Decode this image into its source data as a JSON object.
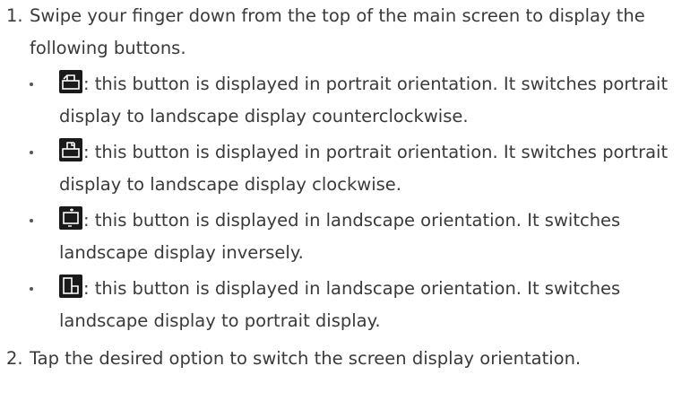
{
  "steps": [
    {
      "number": "1.",
      "text": "Swipe your finger down from the top of the main screen to display the following buttons.",
      "bullets": [
        {
          "icon": "rotate-left-icon",
          "text": ": this button is displayed in portrait orientation. It switches portrait display to landscape display counterclockwise."
        },
        {
          "icon": "rotate-right-icon",
          "text": ": this button is displayed in portrait orientation. It switches portrait display to landscape display clockwise."
        },
        {
          "icon": "flip-icon",
          "text": ": this button is displayed in landscape orientation. It switches landscape display inversely."
        },
        {
          "icon": "portrait-icon",
          "text": ": this button is displayed in landscape orientation. It switches landscape display to portrait display."
        }
      ]
    },
    {
      "number": "2.",
      "text": "Tap the desired option to switch the screen display orientation."
    }
  ]
}
